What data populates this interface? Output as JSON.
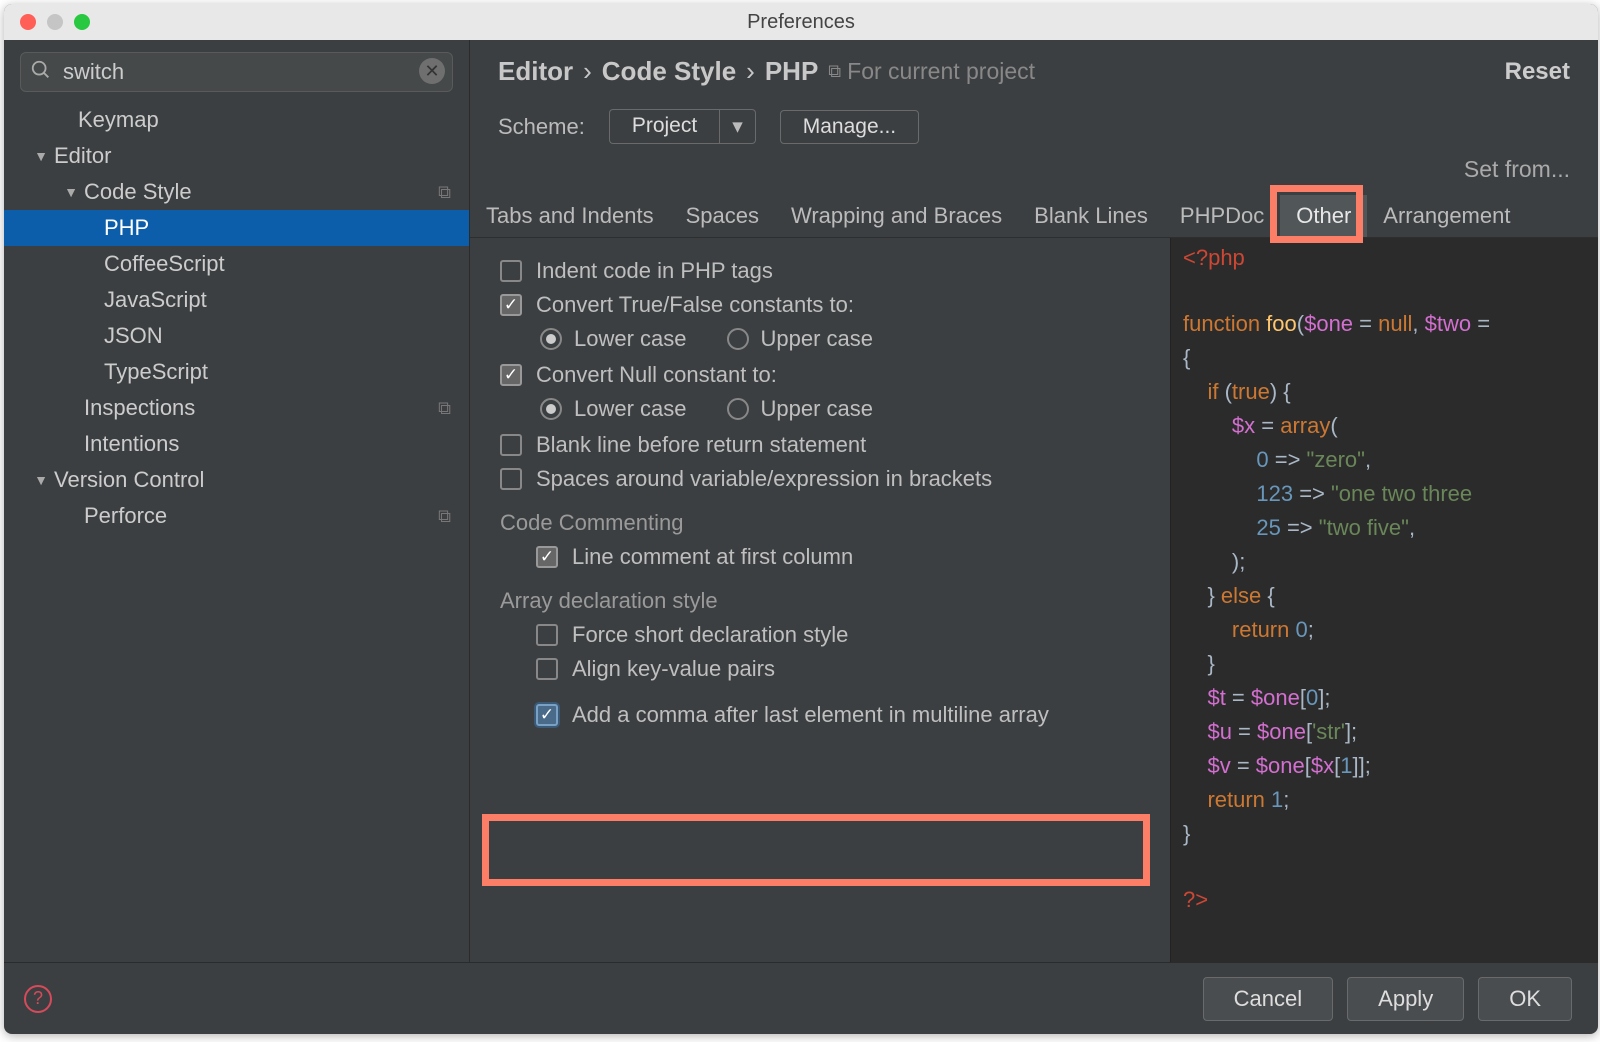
{
  "window": {
    "title": "Preferences"
  },
  "search": {
    "value": "switch"
  },
  "sidebar": {
    "items": [
      {
        "label": "Keymap",
        "depth": 0,
        "chevron": false
      },
      {
        "label": "Editor",
        "depth": 1,
        "chevron": true
      },
      {
        "label": "Code Style",
        "depth": 2,
        "chevron": true,
        "copy": true
      },
      {
        "label": "PHP",
        "depth": 3,
        "selected": true
      },
      {
        "label": "CoffeeScript",
        "depth": 3
      },
      {
        "label": "JavaScript",
        "depth": 3
      },
      {
        "label": "JSON",
        "depth": 3
      },
      {
        "label": "TypeScript",
        "depth": 3
      },
      {
        "label": "Inspections",
        "depth": 2,
        "copy": true
      },
      {
        "label": "Intentions",
        "depth": 2
      },
      {
        "label": "Version Control",
        "depth": 1,
        "chevron": true
      },
      {
        "label": "Perforce",
        "depth": 2,
        "copy": true
      }
    ]
  },
  "breadcrumb": {
    "a": "Editor",
    "b": "Code Style",
    "c": "PHP",
    "note": "For current project"
  },
  "reset_label": "Reset",
  "scheme": {
    "label": "Scheme:",
    "value": "Project",
    "manage": "Manage..."
  },
  "set_from": "Set from...",
  "tabs": [
    "Tabs and Indents",
    "Spaces",
    "Wrapping and Braces",
    "Blank Lines",
    "PHPDoc",
    "Other",
    "Arrangement"
  ],
  "active_tab": "Other",
  "options": {
    "indent_php": "Indent code in PHP tags",
    "convert_tf": "Convert True/False constants to:",
    "lower": "Lower case",
    "upper": "Upper case",
    "convert_null": "Convert Null constant to:",
    "blank_return": "Blank line before return statement",
    "spaces_brackets": "Spaces around variable/expression in brackets",
    "sect_comment": "Code Commenting",
    "line_comment": "Line comment at first column",
    "sect_array": "Array declaration style",
    "force_short": "Force short declaration style",
    "align_kv": "Align key-value pairs",
    "add_comma": "Add a comma after last element in multiline array"
  },
  "footer": {
    "cancel": "Cancel",
    "apply": "Apply",
    "ok": "OK"
  },
  "code": {
    "l1": "<?php",
    "l2a": "function ",
    "l2b": "foo",
    "l2c": "(",
    "l2d": "$one",
    "l2e": " = ",
    "l2f": "null",
    "l2g": ", ",
    "l2h": "$two",
    "l2i": " = ",
    "l3": "{",
    "l4a": "    if ",
    "l4b": "(",
    "l4c": "true",
    "l4d": ") {",
    "l5a": "        ",
    "l5b": "$x",
    "l5c": " = ",
    "l5d": "array",
    "l5e": "(",
    "l6a": "            ",
    "l6b": "0",
    "l6c": " => ",
    "l6d": "\"zero\"",
    "l6e": ",",
    "l7a": "            ",
    "l7b": "123",
    "l7c": " => ",
    "l7d": "\"one two three",
    "l7e": "",
    "l8a": "            ",
    "l8b": "25",
    "l8c": " => ",
    "l8d": "\"two five\"",
    "l8e": ",",
    "l9": "        );",
    "l10a": "    } ",
    "l10b": "else ",
    "l10c": "{",
    "l11a": "        return ",
    "l11b": "0",
    "l11c": ";",
    "l12": "    }",
    "l13a": "    ",
    "l13b": "$t",
    "l13c": " = ",
    "l13d": "$one",
    "l13e": "[",
    "l13f": "0",
    "l13g": "];",
    "l14a": "    ",
    "l14b": "$u",
    "l14c": " = ",
    "l14d": "$one",
    "l14e": "[",
    "l14f": "'str'",
    "l14g": "];",
    "l15a": "    ",
    "l15b": "$v",
    "l15c": " = ",
    "l15d": "$one",
    "l15e": "[",
    "l15f": "$x",
    "l15g": "[",
    "l15h": "1",
    "l15i": "]];",
    "l16a": "    return ",
    "l16b": "1",
    "l16c": ";",
    "l17": "}",
    "l18": "?>"
  }
}
